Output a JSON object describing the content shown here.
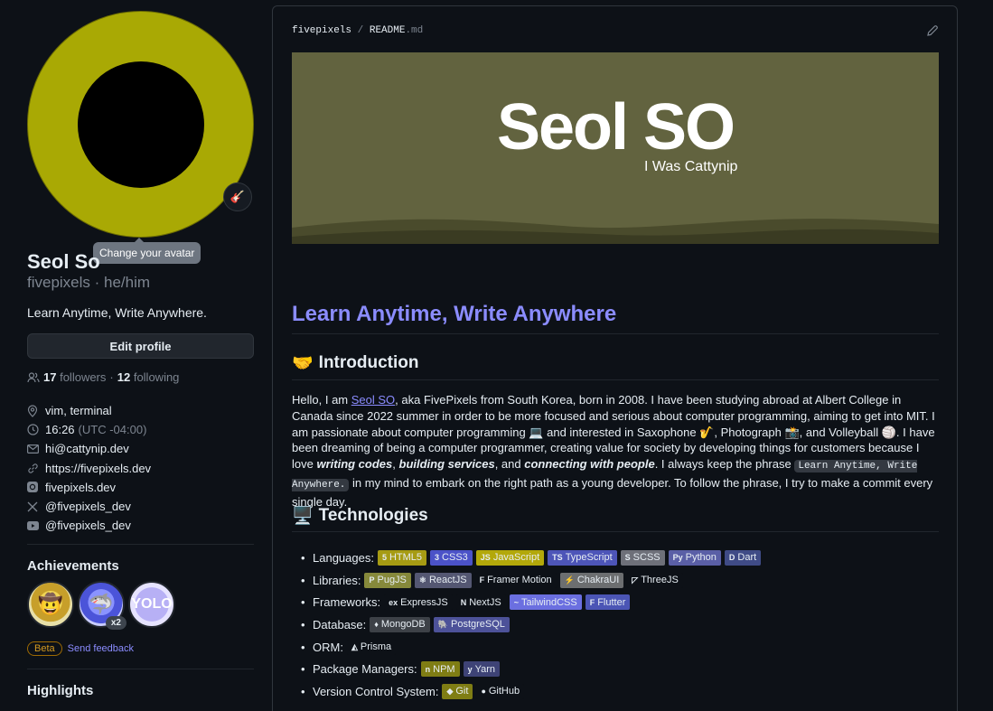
{
  "sidebar": {
    "status_emoji": "🎸",
    "tooltip": "Change your avatar",
    "name": "Seol So",
    "handle": "fivepixels · he/him",
    "bio": "Learn Anytime, Write Anywhere.",
    "edit_profile": "Edit profile",
    "followers_count": "17",
    "followers_label": "followers",
    "following_sep": "·",
    "following_count": "12",
    "following_label": "following",
    "details": {
      "location": "vim, terminal",
      "time": "16:26",
      "timezone": "(UTC -04:00)",
      "email": "hi@cattynip.dev",
      "website": "https://fivepixels.dev",
      "instagram": "fivepixels.dev",
      "x": "@fivepixels_dev",
      "youtube": "@fivepixels_dev"
    },
    "achievements_title": "Achievements",
    "achievement_count": "x2",
    "achievement_yolo": "YOLO",
    "beta": "Beta",
    "send_feedback": "Send feedback",
    "highlights_title": "Highlights"
  },
  "readme": {
    "owner": "fivepixels",
    "sep": "/",
    "file": "README",
    "ext": ".md",
    "banner_title": "Seol SO",
    "banner_subtitle": "I Was Cattynip",
    "h1": "Learn Anytime, Write Anywhere",
    "intro_emoji": "🤝",
    "intro_title": "Introduction",
    "para": {
      "p1": "Hello, I am ",
      "link": "Seol SO",
      "p2": ", aka FivePixels from South Korea, born in 2008. I have been studying abroad at Albert College in Canada since 2022 summer in order to be more focused and serious about computer programming, aiming to get into MIT. I am passionate about computer programming 💻 and interested in Saxophone 🎷, Photograph 📸, and Volleyball 🏐. I have been dreaming of being a computer programmer, creating value for society by developing things for customers because I love ",
      "em1": "writing codes",
      "c1": ", ",
      "em2": "building services",
      "c2": ", and ",
      "em3": "connecting with people",
      "p3": ". I always keep the phrase ",
      "code": "Learn Anytime, Write Anywhere.",
      "p4": " in my mind to embark on the right path as a young developer. To follow the phrase, I try to make a commit every single day."
    },
    "tech_emoji": "🖥️",
    "tech_title": "Technologies",
    "tech_rows": [
      {
        "label": "Languages:",
        "tags": [
          {
            "name": "HTML5",
            "icon": "5",
            "color": "#a69b13"
          },
          {
            "name": "CSS3",
            "icon": "3",
            "color": "#4b52c8"
          },
          {
            "name": "JavaScript",
            "icon": "JS",
            "color": "#b3a80a"
          },
          {
            "name": "TypeScript",
            "icon": "TS",
            "color": "#4d55b8"
          },
          {
            "name": "SCSS",
            "icon": "S",
            "color": "#6e7079"
          },
          {
            "name": "Python",
            "icon": "Py",
            "color": "#5a5fa6"
          },
          {
            "name": "Dart",
            "icon": "D",
            "color": "#3f4b86"
          }
        ]
      },
      {
        "label": "Libraries:",
        "tags": [
          {
            "name": "PugJS",
            "icon": "P",
            "color": "#86893b"
          },
          {
            "name": "ReactJS",
            "icon": "⚛",
            "color": "#545772"
          },
          {
            "name": "Framer Motion",
            "icon": "F",
            "color": "#0d1117"
          },
          {
            "name": "ChakraUI",
            "icon": "⚡",
            "color": "#6c6e70"
          },
          {
            "name": "ThreeJS",
            "icon": "◸",
            "color": "#0d1117"
          }
        ]
      },
      {
        "label": "Frameworks:",
        "tags": [
          {
            "name": "ExpressJS",
            "icon": "ex",
            "color": "#0d1117"
          },
          {
            "name": "NextJS",
            "icon": "N",
            "color": "#0d1117"
          },
          {
            "name": "TailwindCSS",
            "icon": "~",
            "color": "#6b6fe0"
          },
          {
            "name": "Flutter",
            "icon": "F",
            "color": "#4b55b5"
          }
        ]
      },
      {
        "label": "Database:",
        "tags": [
          {
            "name": "MongoDB",
            "icon": "♦",
            "color": "#3d4147"
          },
          {
            "name": "PostgreSQL",
            "icon": "🐘",
            "color": "#4d5299"
          }
        ]
      },
      {
        "label": "ORM:",
        "tags": [
          {
            "name": "Prisma",
            "icon": "◭",
            "color": "#0d1117"
          }
        ]
      },
      {
        "label": "Package Managers:",
        "tags": [
          {
            "name": "NPM",
            "icon": "n",
            "color": "#7f7d14"
          },
          {
            "name": "Yarn",
            "icon": "y",
            "color": "#3e4376"
          }
        ]
      },
      {
        "label": "Version Control System:",
        "tags": [
          {
            "name": "Git",
            "icon": "◆",
            "color": "#7f7d14"
          },
          {
            "name": "GitHub",
            "icon": "●",
            "color": "#0d1117"
          }
        ]
      }
    ]
  }
}
